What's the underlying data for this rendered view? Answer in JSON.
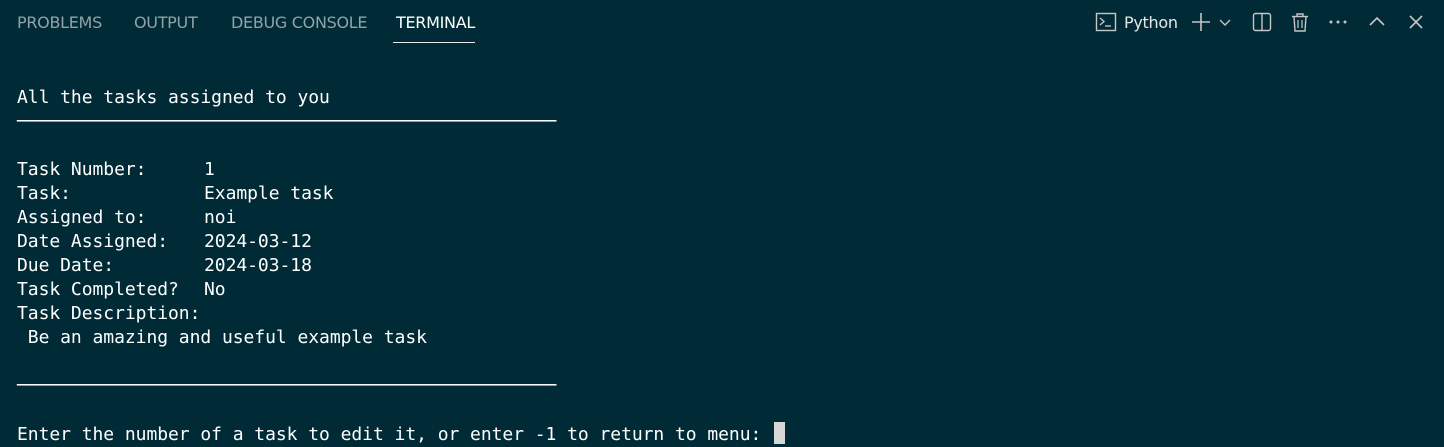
{
  "tabs": {
    "problems": "PROBLEMS",
    "output": "OUTPUT",
    "debug_console": "DEBUG CONSOLE",
    "terminal": "TERMINAL"
  },
  "toolbar": {
    "shell_label": "Python"
  },
  "terminal": {
    "heading": "All the tasks assigned to you",
    "separator": "──────────────────────────────────────────────────",
    "fields": [
      {
        "key": "Task Number:",
        "value": "1"
      },
      {
        "key": "Task:",
        "value": "Example task"
      },
      {
        "key": "Assigned to:",
        "value": "noi"
      },
      {
        "key": "Date Assigned:",
        "value": "2024-03-12"
      },
      {
        "key": "Due Date:",
        "value": "2024-03-18"
      },
      {
        "key": "Task Completed?",
        "value": "No"
      },
      {
        "key": "Task Description:",
        "value": ""
      }
    ],
    "description": " Be an amazing and useful example task",
    "prompt": "Enter the number of a task to edit it, or enter -1 to return to menu: "
  }
}
